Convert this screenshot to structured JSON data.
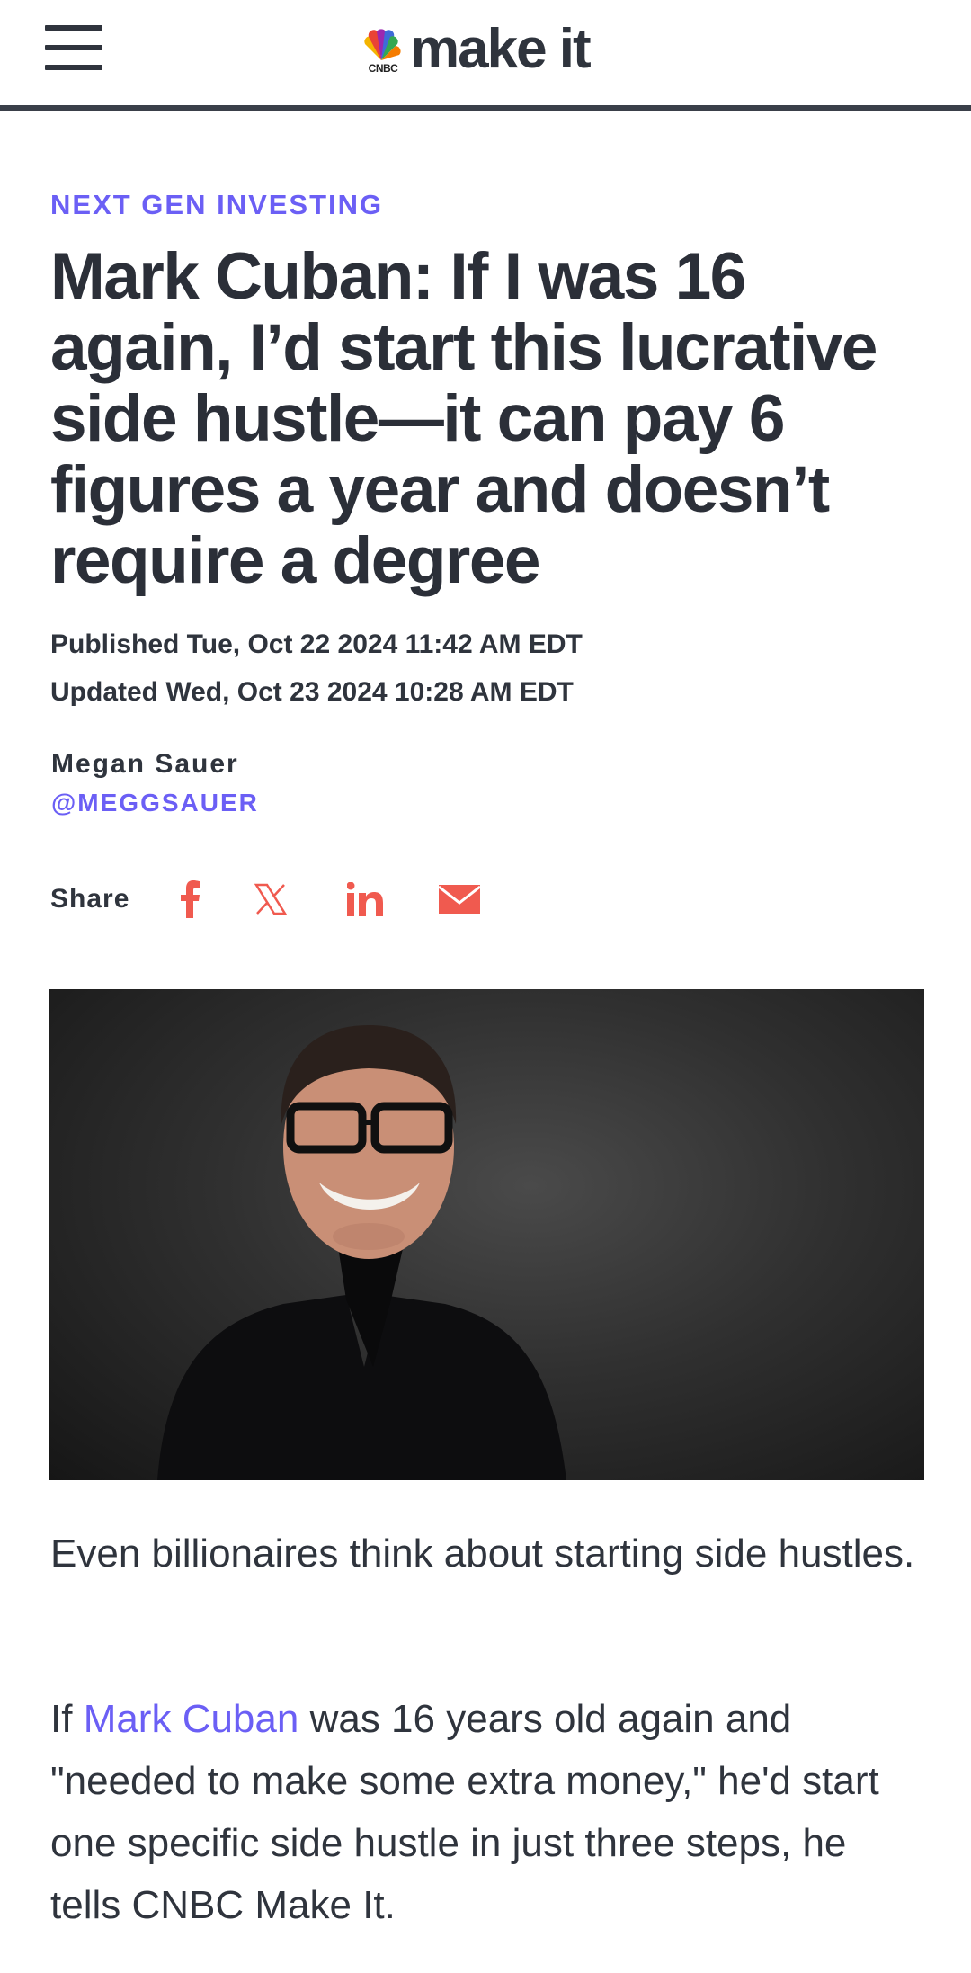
{
  "header": {
    "logo_network": "CNBC",
    "logo_text": "make it"
  },
  "article": {
    "kicker": "NEXT GEN INVESTING",
    "headline": "Mark Cuban: If I was 16 again, I’d start this lucrative side hustle—it can pay 6 figures a year and doesn’t require a degree",
    "published": "Published Tue, Oct 22 2024 11:42 AM EDT",
    "updated": "Updated Wed, Oct 23 2024 10:28 AM EDT",
    "author_name": "Megan Sauer",
    "author_handle": "@MEGGSAUER",
    "share_label": "Share",
    "share_icons": [
      "facebook-icon",
      "x-icon",
      "linkedin-icon",
      "email-icon"
    ],
    "paragraph1": "Even billionaires think about starting side hustles.",
    "paragraph2_prefix": "If ",
    "paragraph2_link": "Mark Cuban",
    "paragraph2_rest": " was 16 years old again and \"needed to make some extra money,\" he'd start one specific side hustle in just three steps, he tells CNBC Make It."
  },
  "colors": {
    "accent": "#6b5ff5",
    "share_icon": "#f05a4f",
    "text": "#2f343d",
    "logo_dot": "#3ad1b3"
  }
}
